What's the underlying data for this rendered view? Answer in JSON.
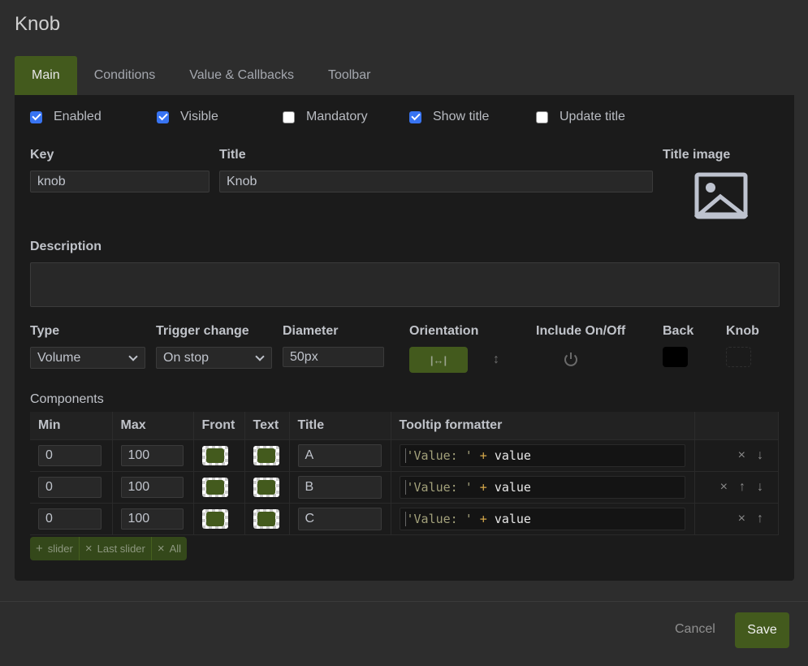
{
  "dialog": {
    "title": "Knob"
  },
  "tabs": [
    {
      "label": "Main",
      "active": true
    },
    {
      "label": "Conditions",
      "active": false
    },
    {
      "label": "Value & Callbacks",
      "active": false
    },
    {
      "label": "Toolbar",
      "active": false
    }
  ],
  "checkboxes": [
    {
      "label": "Enabled",
      "checked": true
    },
    {
      "label": "Visible",
      "checked": true
    },
    {
      "label": "Mandatory",
      "checked": false
    },
    {
      "label": "Show title",
      "checked": true
    },
    {
      "label": "Update title",
      "checked": false
    }
  ],
  "fields": {
    "key": {
      "label": "Key",
      "value": "knob"
    },
    "title": {
      "label": "Title",
      "value": "Knob"
    },
    "title_image": {
      "label": "Title image",
      "icon": "image-placeholder-icon"
    },
    "description": {
      "label": "Description",
      "value": ""
    },
    "type": {
      "label": "Type",
      "value": "Volume"
    },
    "trigger_change": {
      "label": "Trigger change",
      "value": "On stop"
    },
    "diameter": {
      "label": "Diameter",
      "value": "50px"
    },
    "orientation": {
      "label": "Orientation",
      "selected": "horizontal",
      "options": [
        "horizontal",
        "vertical"
      ],
      "horizontal_glyph": "|↔|",
      "vertical_glyph": "↕"
    },
    "include_on_off": {
      "label": "Include On/Off",
      "icon": "power-icon",
      "glyph": "⏻"
    },
    "back": {
      "label": "Back",
      "color": "#000000"
    },
    "knob": {
      "label": "Knob",
      "color": "transparent"
    }
  },
  "components": {
    "label": "Components",
    "columns": [
      "Min",
      "Max",
      "Front",
      "Text",
      "Title",
      "Tooltip formatter",
      ""
    ],
    "rows": [
      {
        "min": "0",
        "max": "100",
        "front": "#435a1d",
        "text": "#435a1d",
        "title": "A",
        "tooltip_str": "'Value: '",
        "tooltip_op": "+",
        "tooltip_var": "value",
        "actions": [
          "×",
          "↓"
        ]
      },
      {
        "min": "0",
        "max": "100",
        "front": "#435a1d",
        "text": "#435a1d",
        "title": "B",
        "tooltip_str": "'Value: '",
        "tooltip_op": "+",
        "tooltip_var": "value",
        "actions": [
          "×",
          "↑",
          "↓"
        ]
      },
      {
        "min": "0",
        "max": "100",
        "front": "#435a1d",
        "text": "#435a1d",
        "title": "C",
        "tooltip_str": "'Value: '",
        "tooltip_op": "+",
        "tooltip_var": "value",
        "actions": [
          "×",
          "↑"
        ]
      }
    ],
    "buttons": {
      "add": {
        "icon": "+",
        "label": "slider"
      },
      "remove_last": {
        "icon": "×",
        "label": "Last slider"
      },
      "remove_all": {
        "icon": "×",
        "label": "All"
      }
    }
  },
  "footer": {
    "cancel_label": "Cancel",
    "save_label": "Save"
  },
  "colors": {
    "accent": "#435a1d",
    "checkbox": "#3874f2",
    "panel": "#1b1b1b",
    "background": "#2d2d2d"
  }
}
